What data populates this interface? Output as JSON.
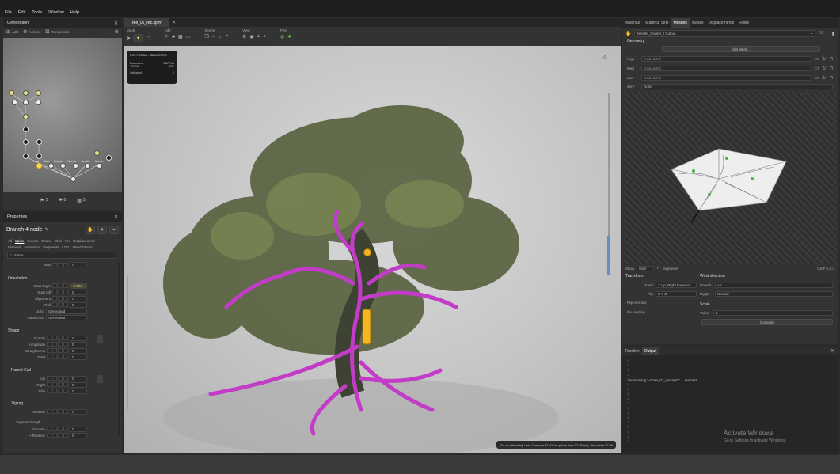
{
  "menu": [
    "File",
    "Edit",
    "Tools",
    "Window",
    "Help"
  ],
  "generation": {
    "title": "Generation",
    "add": "Add",
    "actions": "Actions",
    "randomize": "Randomize",
    "counts": [
      "5",
      "0",
      "5"
    ]
  },
  "node_labels": [
    "Leaf",
    "Stick",
    "Branch",
    "Branch",
    "Needle",
    "Needle",
    "Cluster"
  ],
  "properties": {
    "title": "Properties",
    "node_name": "Branch 4 node",
    "tabs_row1": [
      "All",
      "Spine",
      "Forces",
      "Shape",
      "Skin",
      "UV",
      "Displacement"
    ],
    "tabs_row2": [
      "Material",
      "Animation",
      "Segments",
      "LOD",
      "Hand Drawn"
    ],
    "search": "Spine",
    "max_label": "Max",
    "max_value": "0",
    "orientation": {
      "title": "Orientation",
      "start_angle_label": "Start angle",
      "start_angle_value": "-0.993",
      "start_roll_label": "Start roll",
      "start_roll_value": "0",
      "alignment_label": "Alignment",
      "alignment_value": "0",
      "roll_label": "Roll",
      "roll_value": "0",
      "up_label": "Up(s)",
      "up_value": "Generated",
      "metachurl_label": "Meta churl",
      "metachurl_value": "Generated"
    },
    "shape": {
      "title": "Shape",
      "gravity_label": "Gravity",
      "gravity_value": "0",
      "amplitude_label": "Amplitude",
      "amplitude_value": "0",
      "straightness_label": "Straightness",
      "straightness_value": "0",
      "twist_label": "Twist",
      "twist_value": "0"
    },
    "parent_curl": {
      "title": "Parent Curl",
      "up_label": "Up",
      "up_value": "0",
      "right_label": "Right",
      "right_value": "0",
      "side_label": "Side",
      "side_value": "0"
    },
    "zigzag": {
      "title": "Zigzag",
      "intensity_label": "Intensity",
      "intensity_value": "0",
      "segment_length_label": "Segment length",
      "absolute_label": "Absolute",
      "absolute_value": "0",
      "relative_label": "+ Relative",
      "relative_value": "0"
    }
  },
  "document_tab": "Tree_01_rec.spm*",
  "toolbar": {
    "groups": [
      "Mode",
      "Edit",
      "Scene",
      "View",
      "Post"
    ]
  },
  "selection_panel": {
    "title": "POLYGONS - SELECTED",
    "branches_label": "Branches",
    "branches_value": "267 Tris",
    "total_label": "TOTAL",
    "total_value": "267",
    "selected_label": "Selected",
    "selected_value": "1"
  },
  "status_text": "[24 cpu threads], Last Compute 41.42 ms (draw time 17.85 ms), discourse 82.99",
  "right_tabs": [
    "Materials",
    "Material Sets",
    "Meshes",
    "Masks",
    "Displacements",
    "Rules"
  ],
  "mesh": {
    "name": "Needle_Cluster_l Cutout",
    "geometry_label": "Geometry",
    "edit_mesh": "Edit Mesh...",
    "high_label": "High",
    "high_value": "Embedded",
    "med_label": "Med",
    "med_value": "Embedded",
    "low_label": "Low",
    "low_value": "Embedded",
    "wire_label": "Wire",
    "wire_value": "None"
  },
  "preview": {
    "show_label": "Show",
    "show_value": "High",
    "alignment_label": "Alignment",
    "counts": "V:6 F:6 A:4"
  },
  "transform": {
    "title": "Transform",
    "orient_label": "Orient",
    "orient_value": "Z Up, Right Forward",
    "flip_label": "Flip",
    "flip_value": "X Y Z",
    "flip_normals": "Flip normals",
    "fix_winding": "Fix winding"
  },
  "wind": {
    "title": "Wind direction",
    "growth_label": "Growth",
    "growth_value": "+Y",
    "ripple_label": "Ripple",
    "ripple_value": "Normal"
  },
  "scale": {
    "title": "Scale",
    "value_label": "Value",
    "value_value": "1",
    "compute": "Compute"
  },
  "output": {
    "tabs": [
      "Timeline",
      "Output"
    ],
    "log": "Autosaving \"~Tree_01_rec.spm\" ... success."
  },
  "watermark": {
    "title": "Activate Windows",
    "subtitle": "Go to Settings to activate Windows."
  },
  "icons": [
    "close-icon",
    "gear-icon",
    "hand-icon",
    "search-icon",
    "folder-icon",
    "lock-icon",
    "plus-icon"
  ]
}
